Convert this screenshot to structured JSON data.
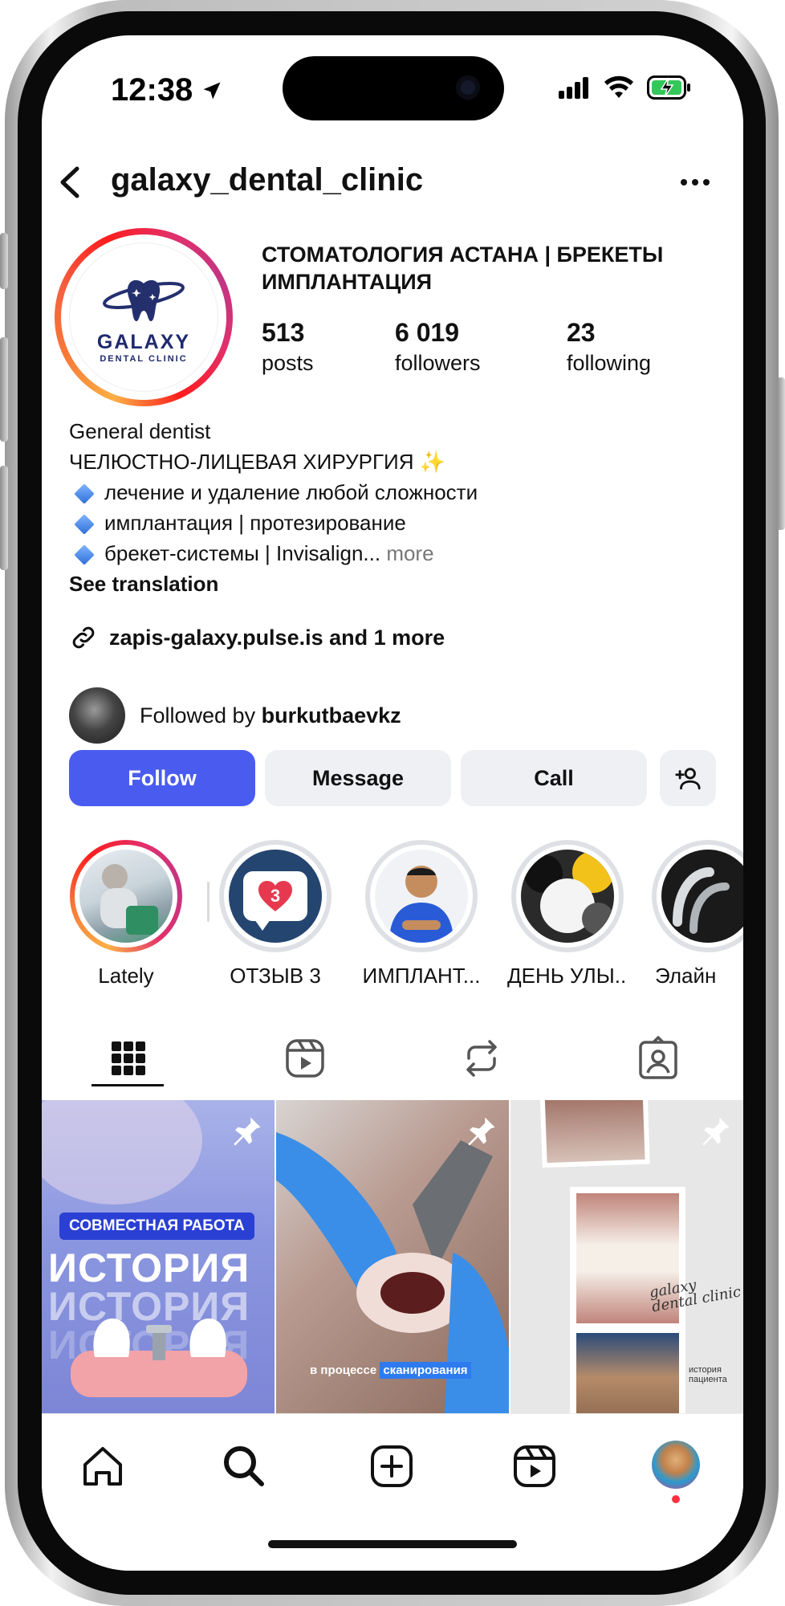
{
  "status_bar": {
    "time": "12:38"
  },
  "header": {
    "username": "galaxy_dental_clinic"
  },
  "profile": {
    "logo_word": "GALAXY",
    "logo_sub": "DENTAL CLINIC",
    "full_name_line1": "СТОМАТОЛОГИЯ АСТАНА | БРЕКЕТЫ",
    "full_name_line2": "ИМПЛАНТАЦИЯ",
    "stats": [
      {
        "value": "513",
        "label": "posts"
      },
      {
        "value": "6 019",
        "label": "followers"
      },
      {
        "value": "23",
        "label": "following"
      }
    ],
    "category": "General dentist",
    "bio_line1": "ЧЕЛЮСТНО-ЛИЦЕВАЯ ХИРУРГИЯ ✨",
    "bio_line2": "лечение и удаление любой сложности",
    "bio_line3": "имплантация | протезирование",
    "bio_line4": "брекет-системы | Invisalign...",
    "more_label": "more",
    "see_translation": "See translation",
    "link": "zapis-galaxy.pulse.is and 1 more",
    "followed_by_prefix": "Followed by",
    "followed_by_user": "burkutbaevkz"
  },
  "actions": {
    "follow": "Follow",
    "message": "Message",
    "call": "Call"
  },
  "highlights": [
    {
      "label": "Lately"
    },
    {
      "label": "ОТЗЫВ 3"
    },
    {
      "label": "ИМПЛАНТ..."
    },
    {
      "label": "ДЕНЬ УЛЫ..."
    },
    {
      "label": "Элайн"
    }
  ],
  "highlight_badge": "3",
  "posts": {
    "tile1_badge": "СОВМЕСТНАЯ РАБОТА",
    "tile1_title": "ИСТОРИЯ",
    "tile2_caption_a": "в процессе",
    "tile2_caption_b": "сканирования",
    "tile3_logo_a": "galaxy",
    "tile3_logo_b": "dental clinic",
    "tile3_note": "история пациента"
  },
  "colors": {
    "follow_button": "#4a5cf0",
    "notification_dot": "#ff3040"
  }
}
